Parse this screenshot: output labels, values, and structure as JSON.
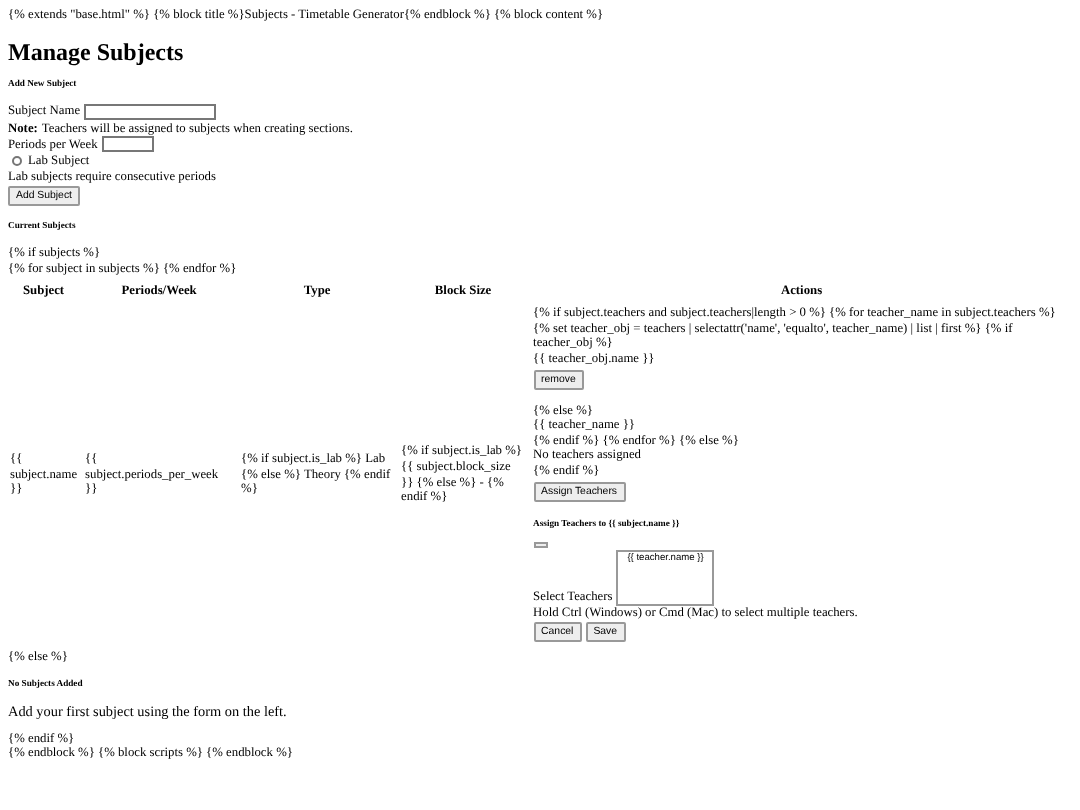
{
  "header_text": "{% extends \"base.html\" %} {% block title %}Subjects - Timetable Generator{% endblock %} {% block content %}",
  "page_title": "Manage Subjects",
  "add_form": {
    "heading": "Add New Subject",
    "name_label": "Subject Name",
    "note_label": "Note:",
    "note_text": "Teachers will be assigned to subjects when creating sections.",
    "periods_label": "Periods per Week",
    "lab_label": "Lab Subject",
    "lab_checked": false,
    "lab_hint": "Lab subjects require consecutive periods",
    "submit": "Add Subject"
  },
  "current_heading": "Current Subjects",
  "pre_table_lines": [
    "{% if subjects %}",
    "{% for subject in subjects %} {% endfor %}"
  ],
  "table": {
    "columns": [
      "Subject",
      "Periods/Week",
      "Type",
      "Block Size",
      "Actions"
    ],
    "row": [
      "{{ subject.name }}",
      "{{ subject.periods_per_week }}",
      "{% if subject.is_lab %} Lab {% else %} Theory {% endif %}",
      "{% if subject.is_lab %} {{ subject.block_size }} {% else %} - {% endif %}"
    ],
    "actions": {
      "teacher_loop": "{% if subject.teachers and subject.teachers|length > 0 %} {% for teacher_name in subject.teachers %} {% set teacher_obj = teachers | selectattr('name', 'equalto', teacher_name) | list | first %} {% if teacher_obj %}",
      "teacher_obj_name": "{{ teacher_obj.name }}",
      "remove_button": "remove",
      "else_lines": [
        "{% else %}",
        "{{ teacher_name }}",
        "{% endif %} {% endfor %} {% else %}",
        "No teachers assigned",
        "{% endif %}"
      ],
      "assign_button": "Assign Teachers",
      "modal": {
        "title": "Assign Teachers to {{ subject.name }}",
        "select_label": "Select Teachers",
        "options": [
          {
            "label": "{{ teacher.name }}",
            "selected": false
          }
        ],
        "hint": "Hold Ctrl (Windows) or Cmd (Mac) to select multiple teachers.",
        "buttons": [
          "Cancel",
          "Save"
        ]
      }
    }
  },
  "else_line": "{% else %}",
  "empty": {
    "heading": "No Subjects Added",
    "text": "Add your first subject using the form on the left."
  },
  "footer_lines": [
    "{% endif %}",
    "{% endblock %} {% block scripts %} {% endblock %}"
  ]
}
